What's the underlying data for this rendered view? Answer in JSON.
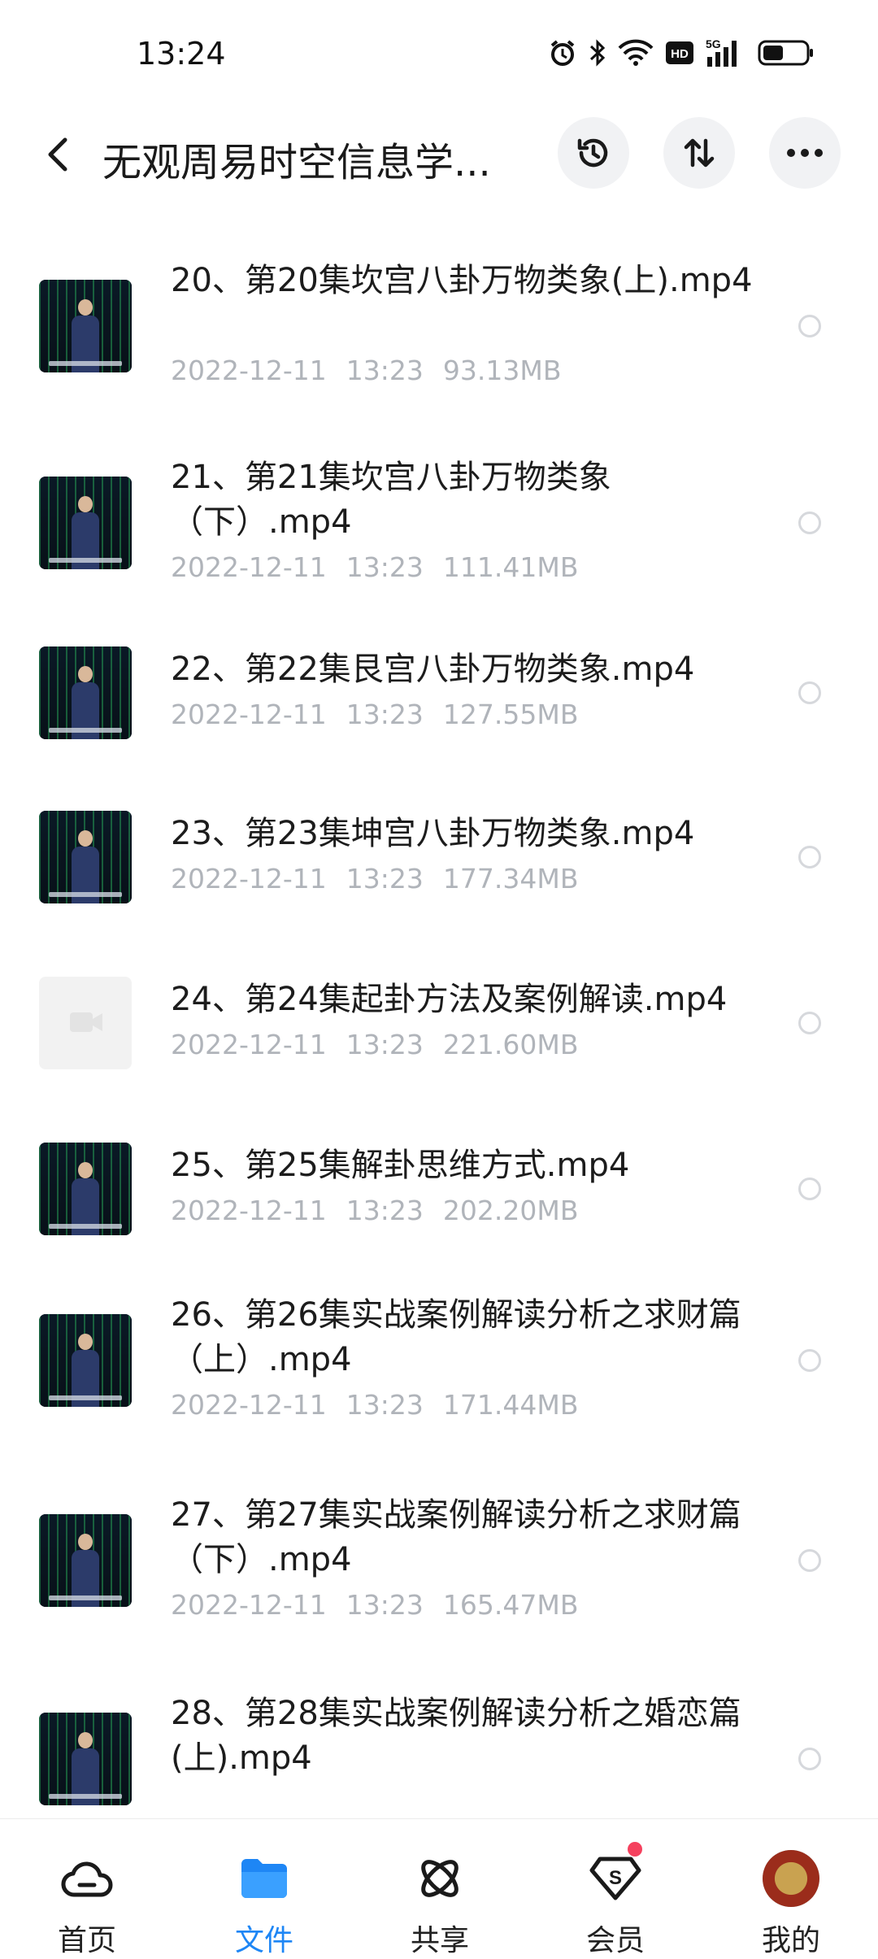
{
  "status": {
    "time": "13:24",
    "icons": [
      "alarm-icon",
      "bluetooth-icon",
      "wifi-icon",
      "hd-icon",
      "signal-5g-icon",
      "battery-icon"
    ],
    "hd_label": "HD",
    "net_label": "5G"
  },
  "header": {
    "title": "无观周易时空信息学...",
    "actions": [
      "history-icon",
      "sort-icon",
      "more-icon"
    ]
  },
  "files": [
    {
      "name": "20、第20集坎宫八卦万物类象(上).mp4",
      "date": "2022-12-11",
      "time": "13:23",
      "size": "93.13MB",
      "thumb": "video"
    },
    {
      "name": "21、第21集坎宫八卦万物类象（下）.mp4",
      "date": "2022-12-11",
      "time": "13:23",
      "size": "111.41MB",
      "thumb": "video"
    },
    {
      "name": "22、第22集艮宫八卦万物类象.mp4",
      "date": "2022-12-11",
      "time": "13:23",
      "size": "127.55MB",
      "thumb": "video"
    },
    {
      "name": "23、第23集坤宫八卦万物类象.mp4",
      "date": "2022-12-11",
      "time": "13:23",
      "size": "177.34MB",
      "thumb": "video"
    },
    {
      "name": "24、第24集起卦方法及案例解读.mp4",
      "date": "2022-12-11",
      "time": "13:23",
      "size": "221.60MB",
      "thumb": "generic"
    },
    {
      "name": "25、第25集解卦思维方式.mp4",
      "date": "2022-12-11",
      "time": "13:23",
      "size": "202.20MB",
      "thumb": "video"
    },
    {
      "name": "26、第26集实战案例解读分析之求财篇（上）.mp4",
      "date": "2022-12-11",
      "time": "13:23",
      "size": "171.44MB",
      "thumb": "video"
    },
    {
      "name": "27、第27集实战案例解读分析之求财篇（下）.mp4",
      "date": "2022-12-11",
      "time": "13:23",
      "size": "165.47MB",
      "thumb": "video"
    },
    {
      "name": "28、第28集实战案例解读分析之婚恋篇(上).mp4",
      "date": "",
      "time": "",
      "size": "",
      "thumb": "video"
    }
  ],
  "nav": [
    {
      "label": "首页",
      "icon": "home-cloud-icon",
      "active": false
    },
    {
      "label": "文件",
      "icon": "folder-icon",
      "active": true
    },
    {
      "label": "共享",
      "icon": "share-atom-icon",
      "active": false
    },
    {
      "label": "会员",
      "icon": "vip-diamond-icon",
      "active": false,
      "badge": true
    },
    {
      "label": "我的",
      "icon": "avatar",
      "active": false
    }
  ],
  "colors": {
    "accent": "#1e86f5",
    "meta_text": "#b0b4ba",
    "badge": "#f5415e"
  }
}
